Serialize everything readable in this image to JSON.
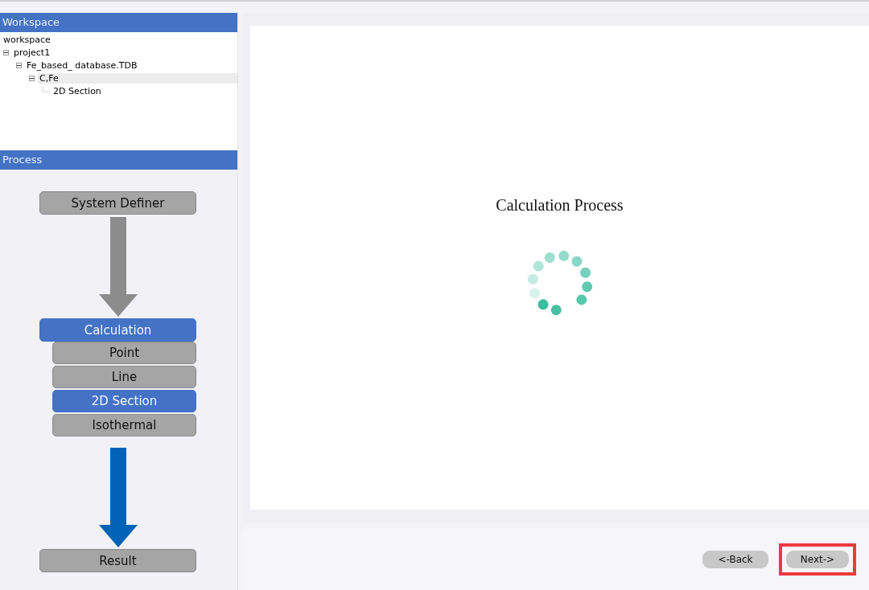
{
  "workspace": {
    "title": "Workspace",
    "tree": [
      {
        "label": "workspace",
        "selected": false,
        "children": [
          {
            "label": "project1",
            "expanded": true,
            "selected": false,
            "children": [
              {
                "label": "Fe_based_ database.TDB",
                "expanded": true,
                "selected": false,
                "children": [
                  {
                    "label": "C,Fe",
                    "expanded": true,
                    "selected": true,
                    "children": [
                      {
                        "label": "2D Section",
                        "selected": false
                      }
                    ]
                  }
                ]
              }
            ]
          }
        ]
      }
    ]
  },
  "process": {
    "title": "Process",
    "flow": [
      {
        "kind": "step",
        "label": "System Definer",
        "selected": false
      },
      {
        "kind": "arrow",
        "active": false
      },
      {
        "kind": "step",
        "label": "Calculation",
        "selected": true
      },
      {
        "kind": "substep",
        "label": "Point",
        "selected": false
      },
      {
        "kind": "substep",
        "label": "Line",
        "selected": false
      },
      {
        "kind": "substep",
        "label": "2D Section",
        "selected": true
      },
      {
        "kind": "substep",
        "label": "Isothermal",
        "selected": false
      },
      {
        "kind": "arrow",
        "active": true
      },
      {
        "kind": "step",
        "label": "Result",
        "selected": false
      }
    ]
  },
  "main": {
    "title": "Calculation Process"
  },
  "buttons": [
    {
      "label": "<-Back",
      "highlighted": false
    },
    {
      "label": "Next->",
      "highlighted": true
    }
  ]
}
